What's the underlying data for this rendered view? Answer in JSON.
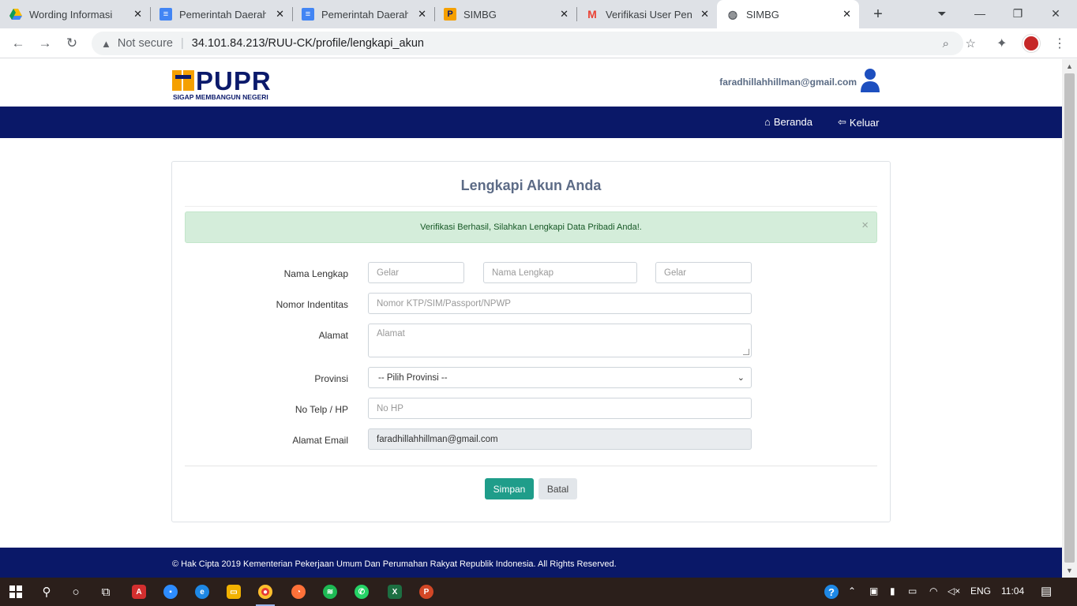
{
  "browser": {
    "tabs": [
      {
        "title": "Wording Informasi",
        "icon": "google-drive-icon",
        "color": "#fbbc04"
      },
      {
        "title": "Pemerintah Daerah",
        "icon": "google-docs-icon",
        "color": "#4285f4"
      },
      {
        "title": "Pemerintah Daerah",
        "icon": "google-docs-icon",
        "color": "#4285f4"
      },
      {
        "title": "SIMBG",
        "icon": "pupr-icon",
        "color": "#f5a000"
      },
      {
        "title": "Verifikasi User Peng",
        "icon": "gmail-icon",
        "color": "#ea4335"
      },
      {
        "title": "SIMBG",
        "icon": "globe-icon",
        "color": "#5f6368"
      }
    ],
    "security_label": "Not secure",
    "url": "34.101.84.213/RUU-CK/profile/lengkapi_akun"
  },
  "site": {
    "logo_word": "PUPR",
    "logo_tagline": "SIGAP MEMBANGUN NEGERI",
    "user_email": "faradhillahhillman@gmail.com",
    "nav": {
      "home": "Beranda",
      "logout": "Keluar"
    },
    "accent_color": "#0a1868"
  },
  "form": {
    "title": "Lengkapi Akun Anda",
    "alert": "Verifikasi Berhasil, Silahkan Lengkapi Data Pribadi Anda!.",
    "labels": {
      "full_name": "Nama Lengkap",
      "id_number": "Nomor Indentitas",
      "address": "Alamat",
      "province": "Provinsi",
      "phone": "No Telp / HP",
      "email": "Alamat Email"
    },
    "placeholders": {
      "title_front": "Gelar",
      "full_name": "Nama Lengkap",
      "title_back": "Gelar",
      "id_number": "Nomor KTP/SIM/Passport/NPWP",
      "address": "Alamat",
      "phone": "No HP"
    },
    "province_selected": "-- Pilih Provinsi --",
    "email_value": "faradhillahhillman@gmail.com",
    "save_label": "Simpan",
    "cancel_label": "Batal"
  },
  "footer": {
    "text": "© Hak Cipta 2019 Kementerian Pekerjaan Umum Dan Perumahan Rakyat Republik Indonesia. All Rights Reserved."
  },
  "taskbar": {
    "lang": "ENG",
    "time": "11:04"
  }
}
